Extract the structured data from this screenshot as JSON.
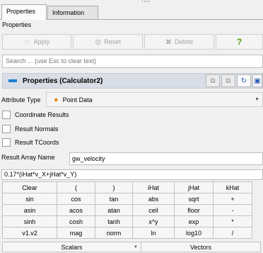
{
  "tabs": [
    {
      "label": "Properties"
    },
    {
      "label": "Information"
    }
  ],
  "section_label": "Properties",
  "toolbar": {
    "apply_label": "Apply",
    "reset_label": "Reset",
    "delete_label": "Delete",
    "help_label": "?"
  },
  "search": {
    "placeholder": "Search ... (use Esc to clear text)"
  },
  "properties_header": {
    "title": "Properties (Calculator2)"
  },
  "attribute_type": {
    "label": "Attribute Type",
    "value": "Point Data"
  },
  "checkboxes": [
    {
      "label": "Coordinate Results",
      "checked": false
    },
    {
      "label": "Result Normals",
      "checked": false
    },
    {
      "label": "Result TCoords",
      "checked": false
    }
  ],
  "result_array": {
    "label": "Result Array Name",
    "value": "gw_velocity"
  },
  "expression": "0.17*(iHat*v_X+jHat*v_Y)",
  "calculator": {
    "keys": [
      [
        "Clear",
        "(",
        ")",
        "iHat",
        "jHat",
        "kHat"
      ],
      [
        "sin",
        "cos",
        "tan",
        "abs",
        "sqrt",
        "+"
      ],
      [
        "asin",
        "acos",
        "atan",
        "ceil",
        "floor",
        "-"
      ],
      [
        "sinh",
        "cosh",
        "tanh",
        "x^y",
        "exp",
        "*"
      ],
      [
        "v1.v2",
        "mag",
        "norm",
        "ln",
        "log10",
        "/"
      ]
    ],
    "scalars_label": "Scalars",
    "vectors_label": "Vectors"
  }
}
